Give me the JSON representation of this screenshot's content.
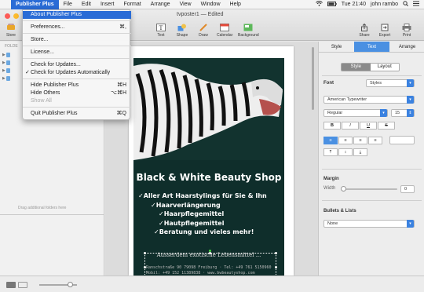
{
  "menubar": {
    "app": "Publisher Plus",
    "items": [
      "File",
      "Edit",
      "Insert",
      "Format",
      "Arrange",
      "View",
      "Window",
      "Help"
    ],
    "clock": "Tue 21:40",
    "user": "john rambo"
  },
  "window": {
    "title": "tvposter1 — Edited",
    "toolbar": {
      "left": [
        "Store"
      ],
      "center": [
        "Text",
        "Shape",
        "Draw",
        "Calendar",
        "Background"
      ],
      "right": [
        "Share",
        "Export",
        "Print"
      ]
    }
  },
  "sidebar": {
    "header": "FOLDE",
    "drag_hint": "Drag additional folders here"
  },
  "app_menu": {
    "items": [
      {
        "label": "About Publisher Plus",
        "shortcut": ""
      },
      {
        "label": "Preferences...",
        "shortcut": "⌘,"
      },
      {
        "label": "Store...",
        "shortcut": ""
      },
      {
        "label": "License...",
        "shortcut": ""
      },
      {
        "label": "Check for Updates...",
        "shortcut": ""
      },
      {
        "label": "Check for Updates Automatically",
        "shortcut": ""
      },
      {
        "label": "Hide Publisher Plus",
        "shortcut": "⌘H"
      },
      {
        "label": "Hide Others",
        "shortcut": "⌥⌘H"
      },
      {
        "label": "Show All",
        "shortcut": ""
      },
      {
        "label": "Quit Publisher Plus",
        "shortcut": "⌘Q"
      }
    ],
    "checkmark": "✓"
  },
  "poster": {
    "title": "Black & White Beauty Shop",
    "lines": [
      "✓Aller Art Haarstylings für Sie & Ihn",
      "✓Haarverlängerung",
      "✓Haarpflegemittel",
      "✓Hautpflegemittel",
      "✓Beratung und vieles mehr!"
    ],
    "extra": "Ausserdem exotische Lebensmittel ...",
    "contact_1": "Ranschstraße 90 79098 Freiburg · Tel: +49 761 5150960",
    "contact_2": "Mobil: +49 152 11389838 · www.bwbeautyshop.com"
  },
  "inspector": {
    "tabs": [
      "Style",
      "Text",
      "Arrange"
    ],
    "active_tab": "Text",
    "subtabs": [
      "Style",
      "Layout"
    ],
    "active_subtab": "Style",
    "font_label": "Font",
    "styles_drop": "Styles",
    "font_family": "American Typewriter",
    "font_style": "Regular",
    "font_size": "15",
    "format_buttons": [
      "B",
      "I",
      "U",
      "S"
    ],
    "margin_label": "Margin",
    "width_label": "Width",
    "width_value": "0",
    "bullets_label": "Bullets & Lists",
    "bullets_value": "None"
  },
  "colors": {
    "accent": "#2a6cd6",
    "poster_bg": "#0f2e2b",
    "folder": "#6ca8e0"
  }
}
